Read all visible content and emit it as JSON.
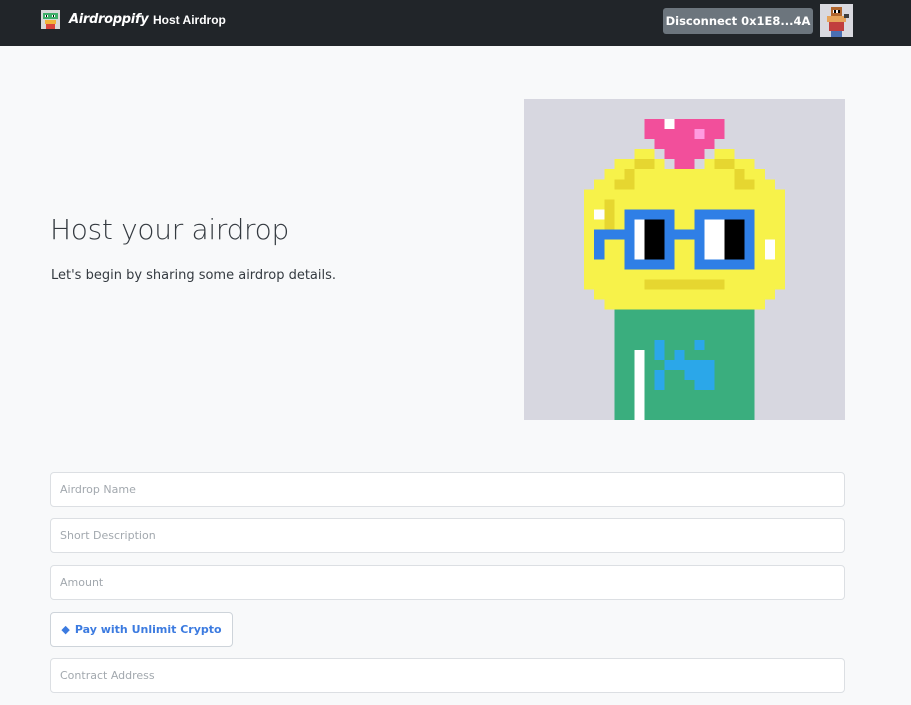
{
  "navbar": {
    "brand_name": "Airdroppify",
    "nav_link": "Host Airdrop",
    "disconnect_label": "Disconnect 0x1E8...4A"
  },
  "hero": {
    "title": "Host your airdrop",
    "subtitle": "Let's begin by sharing some airdrop details."
  },
  "form": {
    "airdrop_name_placeholder": "Airdrop Name",
    "short_description_placeholder": "Short Description",
    "amount_placeholder": "Amount",
    "pay_button_label": "Pay with Unlimit Crypto",
    "pay_button_icon": "ticket-icon",
    "contract_address_placeholder": "Contract Address"
  },
  "colors": {
    "navbar_bg": "#212529",
    "page_bg": "#f8f9fa",
    "disconnect_bg": "#6c757d",
    "accent_blue": "#3c7be0"
  }
}
